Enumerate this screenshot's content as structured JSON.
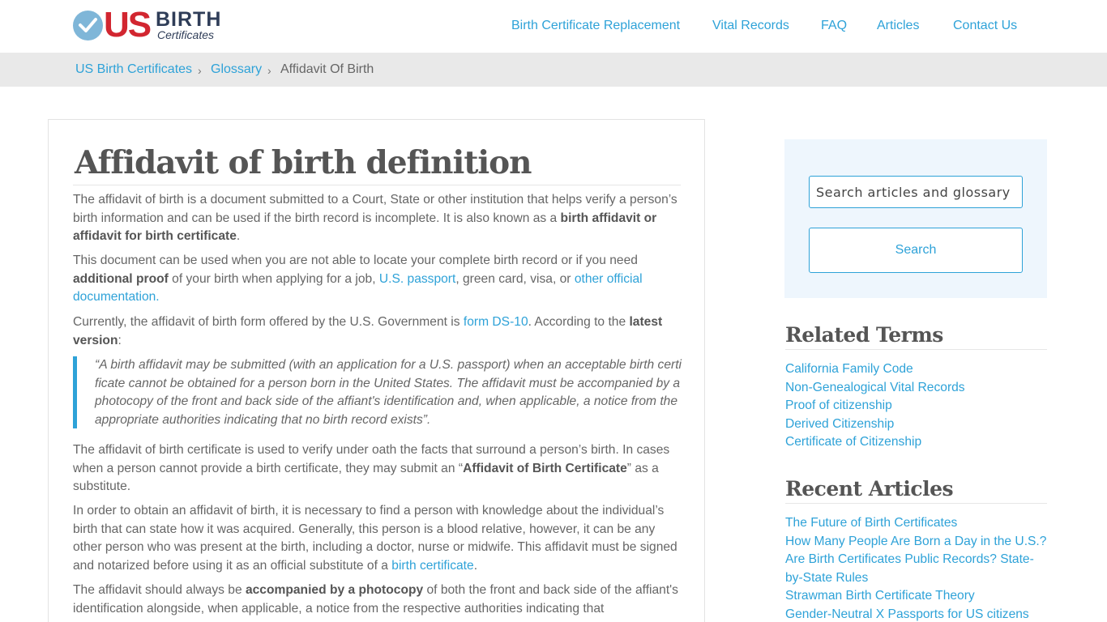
{
  "header": {
    "logo": {
      "us": "US",
      "birth": "BIRTH",
      "certificates": "Certificates"
    },
    "nav": [
      "Birth Certificate Replacement",
      "Vital Records",
      "FAQ",
      "Articles",
      "Contact Us"
    ]
  },
  "breadcrumb": {
    "items": [
      "US Birth Certificates",
      "Glossary",
      "Affidavit Of Birth"
    ],
    "separator": "›"
  },
  "article": {
    "title": "Affidavit of birth definition",
    "p1": {
      "text": "The affidavit of birth is a document submitted to a Court, State or other institution that helps verify a person’s birth information and can be used if the birth record is incomplete. It is also known as a ",
      "bold": "birth affidavit or affidavit for birth certificate",
      "end": "."
    },
    "p2": {
      "a": "This document can be used when you are not able to locate your complete birth record or if you need ",
      "bold": "additional proof",
      "b": " of your birth when applying for a job, ",
      "link1": "U.S. passport",
      "c": ", green card, visa, or ",
      "link2": "other official documentation."
    },
    "p3": {
      "a": "Currently, the affidavit of birth form offered by the U.S. Government is ",
      "link": "form DS-10",
      "b": ". According to the ",
      "bold": "latest version",
      "c": ":"
    },
    "quote": "“A birth affidavit may be submitted (with an application for a U.S. passport) when an acceptable birth certificate cannot be obtained for a person born in the United States. The affidavit must be accompanied by a photocopy of the front and back side of the affiant's identification and, when applicable, a notice from the appropriate authorities indicating that no birth record exists”.",
    "p4": {
      "a": "The affidavit of birth certificate is used to verify under oath the facts that surround a person’s birth. In cases when a person cannot provide a birth certificate, they may submit an “",
      "bold": "Affidavit of Birth Certificate",
      "b": "” as a substitute."
    },
    "p5": {
      "a": "In order to obtain an affidavit of birth, it is necessary to find a person with knowledge about the individual’s birth that can state how it was acquired. Generally, this person is a blood relative, however, it can be any other person who was present at the birth, including a doctor, nurse or midwife. This affidavit must be signed and notarized before using it as an official substitute of a ",
      "link": "birth certificate",
      "b": "."
    },
    "p6": {
      "a": "The affidavit should always be ",
      "bold": "accompanied by a photocopy",
      "b": " of both the front and back side of the affiant's identification alongside, when applicable, a notice from the respective authorities indicating that"
    }
  },
  "sidebar": {
    "search": {
      "placeholder": "Search articles and glossary",
      "button": "Search"
    },
    "related_terms": {
      "title": "Related Terms",
      "items": [
        "California Family Code",
        "Non-Genealogical Vital Records",
        "Proof of citizenship",
        "Derived Citizenship",
        "Certificate of Citizenship"
      ]
    },
    "recent_articles": {
      "title": "Recent Articles",
      "items": [
        "The Future of Birth Certificates",
        "How Many People Are Born a Day in the U.S.?",
        "Are Birth Certificates Public Records? State-by-State Rules",
        "Strawman Birth Certificate Theory",
        "Gender-Neutral X Passports for US citizens"
      ]
    }
  },
  "colors": {
    "accent": "#2ea2d8",
    "logo_red": "#d22630",
    "logo_navy": "#2f3d58",
    "breadcrumb_bg": "#e9e9e9"
  }
}
